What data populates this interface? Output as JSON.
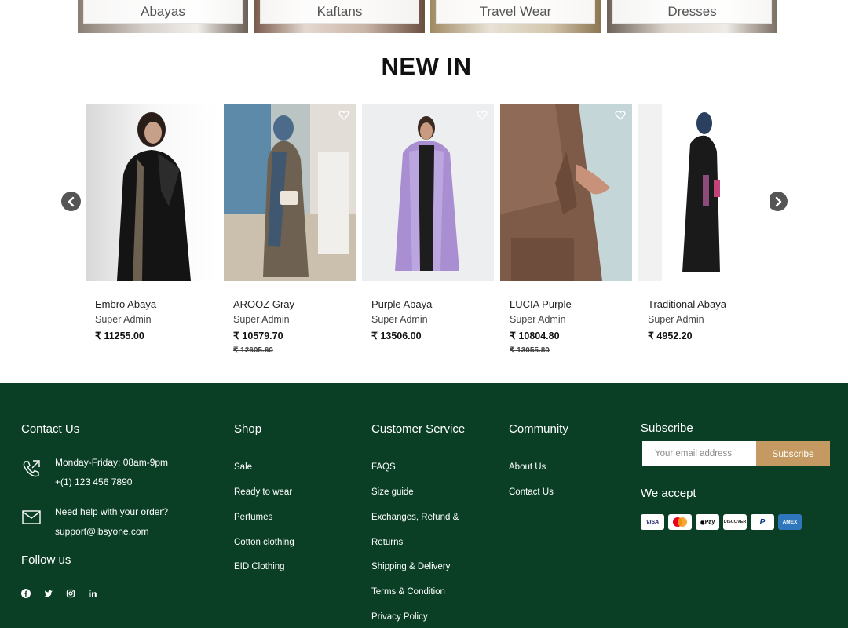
{
  "categories": [
    "Abayas",
    "Kaftans",
    "Travel Wear",
    "Dresses"
  ],
  "section_title": "NEW IN",
  "products": [
    {
      "name": "Embro Abaya",
      "author": "Super Admin",
      "price": "₹ 11255.00",
      "old_price": ""
    },
    {
      "name": "AROOZ Gray",
      "author": "Super Admin",
      "price": "₹ 10579.70",
      "old_price": "₹ 12605.60"
    },
    {
      "name": "Purple Abaya",
      "author": "Super Admin",
      "price": "₹ 13506.00",
      "old_price": ""
    },
    {
      "name": "LUCIA Purple",
      "author": "Super Admin",
      "price": "₹ 10804.80",
      "old_price": "₹ 13055.80"
    },
    {
      "name": "Traditional Abaya",
      "author": "Super Admin",
      "price": "₹ 4952.20",
      "old_price": ""
    }
  ],
  "footer": {
    "contact": {
      "heading": "Contact Us",
      "hours": "Monday-Friday: 08am-9pm",
      "phone": "+(1) 123 456 7890",
      "help": "Need help with your order?",
      "email": "support@lbsyone.com",
      "follow": "Follow us",
      "social_icons": [
        "facebook-icon",
        "twitter-icon",
        "instagram-icon",
        "linkedin-icon"
      ]
    },
    "shop": {
      "heading": "Shop",
      "links": [
        "Sale",
        "Ready to wear",
        "Perfumes",
        "Cotton clothing",
        "EID Clothing"
      ]
    },
    "customer_service": {
      "heading": "Customer Service",
      "links": [
        "FAQS",
        "Size guide",
        "Exchanges, Refund &",
        "Returns",
        "Shipping & Delivery",
        "Terms & Condition",
        "Privacy Policy"
      ]
    },
    "community": {
      "heading": "Community",
      "links": [
        "About Us",
        "Contact Us"
      ]
    },
    "subscribe": {
      "heading": "Subscribe",
      "placeholder": "Your email address",
      "button": "Subscribe",
      "we_accept": "We accept",
      "payments": [
        "VISA",
        "",
        "Pay",
        "DISCOVER",
        "P",
        "AMEX"
      ]
    }
  },
  "colors": {
    "footer_bg": "#0a3f26",
    "subscribe_button": "#c59a62",
    "arrow": "#555555"
  }
}
